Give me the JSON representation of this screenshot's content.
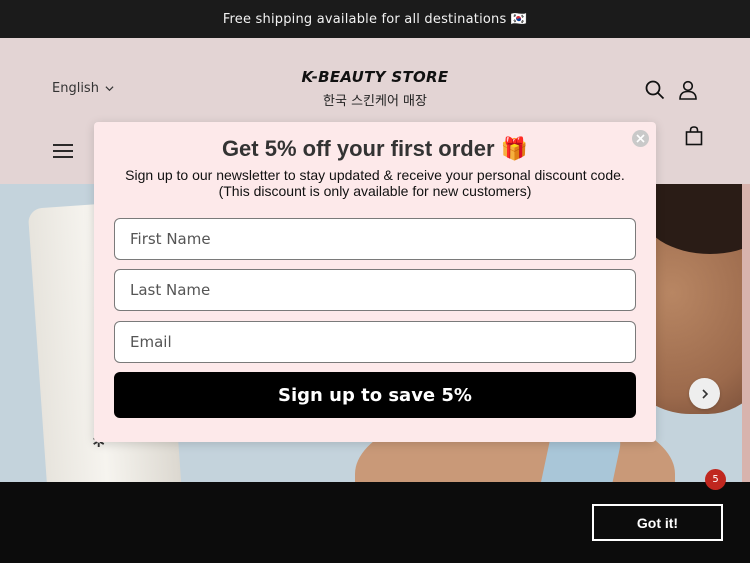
{
  "announcement": {
    "text": "Free shipping available for all destinations 🇰🇷"
  },
  "header": {
    "language": "English",
    "brand": "K-BEAUTY STORE",
    "brand_sub": "한국 스킨케어 매장",
    "icons": [
      "search-icon",
      "account-icon",
      "menu-icon",
      "cart-icon"
    ]
  },
  "hero": {
    "next_arrow": "chevron-right-icon"
  },
  "popup": {
    "title": "Get 5% off your first order 🎁",
    "line1": "Sign up to our newsletter to stay updated & receive your personal discount code.",
    "line2": "(This discount is only available for new customers)",
    "first_name_placeholder": "First Name",
    "last_name_placeholder": "Last Name",
    "email_placeholder": "Email",
    "submit_label": "Sign up to save 5%"
  },
  "cookie": {
    "button_label": "Got it!"
  },
  "chat_badge": {
    "count": "5"
  },
  "colors": {
    "header_bg": "#e3d4d4",
    "popup_bg": "#fde9ea",
    "announcement_bg": "#1b1b1b",
    "badge": "#c0271f"
  }
}
